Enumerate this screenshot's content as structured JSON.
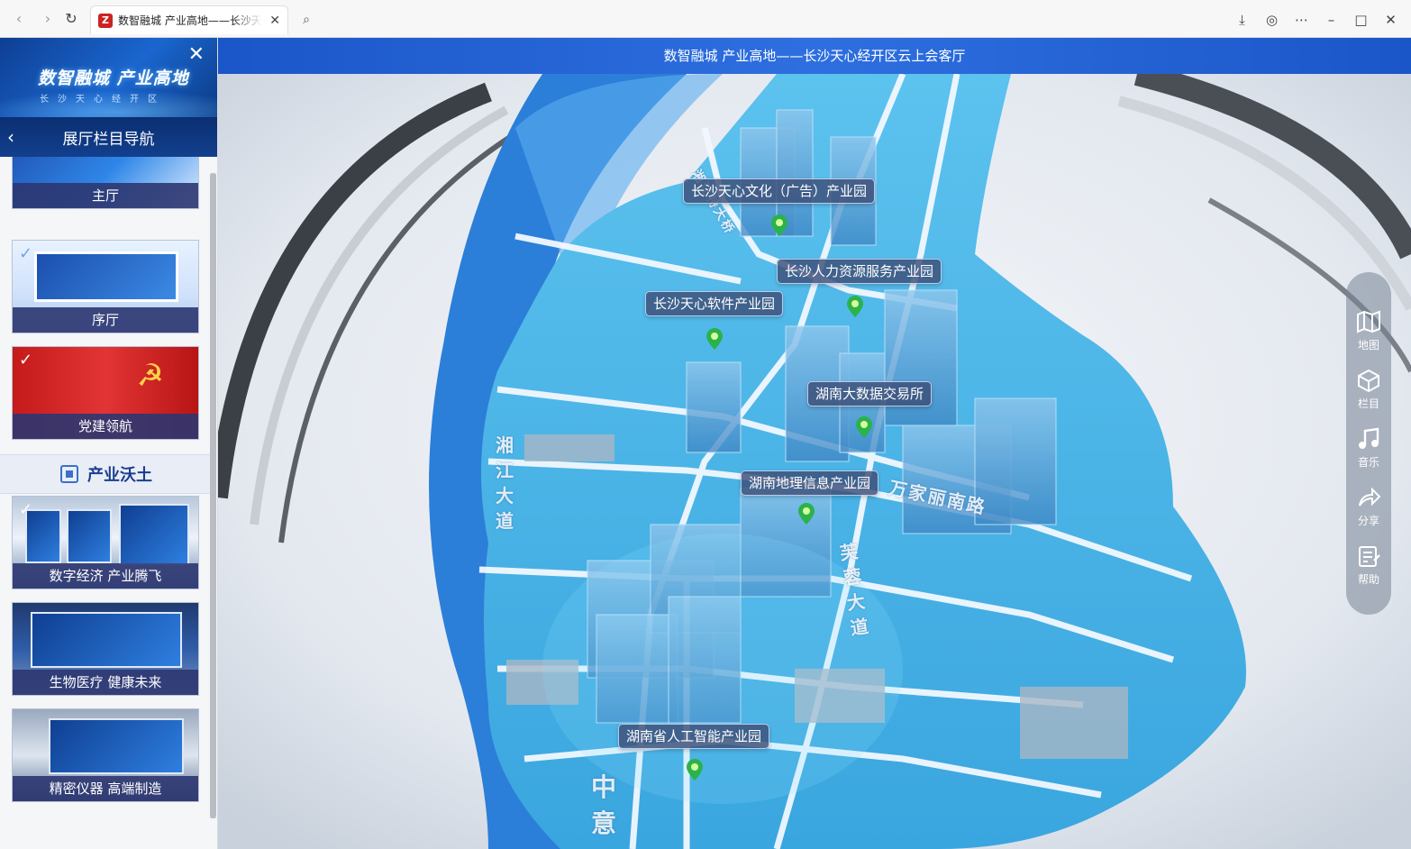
{
  "browser": {
    "tab_title": "数智融城 产业高地——长沙天",
    "tab_favicon": "Z"
  },
  "sidebar": {
    "brand_title": "数智融城 产业高地",
    "brand_subtitle": "长沙天心经开区",
    "nav_title": "展厅栏目导航",
    "items_top": [
      {
        "label": "主厅"
      },
      {
        "label": "序厅"
      },
      {
        "label": "党建领航"
      }
    ],
    "section_title": "产业沃土",
    "items_bottom": [
      {
        "label": "数字经济 产业腾飞"
      },
      {
        "label": "生物医疗 健康未来"
      },
      {
        "label": "精密仪器 高端制造"
      }
    ]
  },
  "main": {
    "title": "数智融城 产业高地——长沙天心经开区云上会客厅",
    "markers": [
      {
        "label": "长沙天心文化（广告）产业园"
      },
      {
        "label": "长沙人力资源服务产业园"
      },
      {
        "label": "长沙天心软件产业园"
      },
      {
        "label": "湖南大数据交易所"
      },
      {
        "label": "湖南地理信息产业园"
      },
      {
        "label": "湖南省人工智能产业园"
      }
    ],
    "streets": {
      "xiangjiang": "湘江大道",
      "wanjia": "万家丽南路",
      "furong": "芙蓉大道",
      "zhong": "中意",
      "bridge": "湘江特大桥"
    }
  },
  "toolbar": {
    "items": [
      {
        "label": "地图",
        "icon": "map-icon"
      },
      {
        "label": "栏目",
        "icon": "cube-icon"
      },
      {
        "label": "音乐",
        "icon": "music-icon"
      },
      {
        "label": "分享",
        "icon": "share-icon"
      },
      {
        "label": "帮助",
        "icon": "help-icon"
      }
    ]
  },
  "colors": {
    "accent": "#2e6fe0",
    "map_water": "#2b7fd8",
    "map_land": "#4fb3e8"
  }
}
